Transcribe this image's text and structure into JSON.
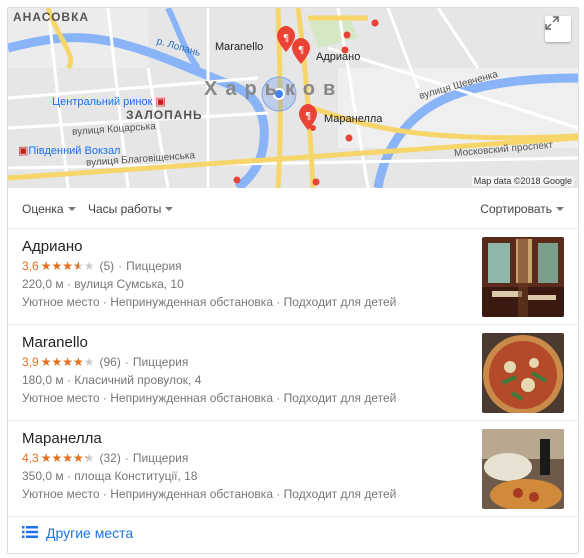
{
  "map": {
    "city_label": "Харьков",
    "attribution": "Map data ©2018 Google",
    "labels": {
      "nasovka": "АНАСОВКА",
      "lopan": "р. Лопань",
      "market": "Центральний ринок",
      "zalopan": "ЗАЛОПАНЬ",
      "koczarska": "вулиця Коцарська",
      "south_station": "Південний Вокзал",
      "blagovishchenska": "вулиця Благовіщенська",
      "shevchenka": "вулиця Шевченка",
      "moscow_prospect": "Московский проспект"
    },
    "pins": {
      "maranello": "Maranello",
      "adriano": "Адриано",
      "maranella": "Маранелла"
    }
  },
  "filters": {
    "rating": "Оценка",
    "hours": "Часы работы",
    "sort": "Сортировать"
  },
  "results": [
    {
      "name": "Адриано",
      "rating": "3,6",
      "rating_value": 3.6,
      "reviews": "(5)",
      "type": "Пиццерия",
      "distance_address": "220,0 м · вулиця Сумська, 10",
      "features": "Уютное место · Непринужденная обстановка · Подходит для детей"
    },
    {
      "name": "Maranello",
      "rating": "3,9",
      "rating_value": 3.9,
      "reviews": "(96)",
      "type": "Пиццерия",
      "distance_address": "180,0 м · Класичний провулок, 4",
      "features": "Уютное место · Непринужденная обстановка · Подходит для детей"
    },
    {
      "name": "Маранелла",
      "rating": "4,3",
      "rating_value": 4.3,
      "reviews": "(32)",
      "type": "Пиццерия",
      "distance_address": "350,0 м · площа Конституції, 18",
      "features": "Уютное место · Непринужденная обстановка · Подходит для детей"
    }
  ],
  "stars_glyph": "★★★★★",
  "separator": "·",
  "more_places": "Другие места",
  "colors": {
    "star": "#e7711b",
    "link": "#1a73e8",
    "pin": "#ea4335",
    "water": "#8ab4f8",
    "major_road": "#f6d66b"
  },
  "icons": {
    "expand": "expand-icon",
    "list": "list-icon",
    "restaurant_pin": "restaurant-pin-icon",
    "location": "my-location-icon"
  }
}
